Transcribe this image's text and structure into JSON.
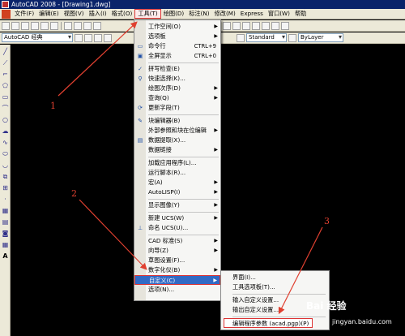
{
  "window": {
    "title": "AutoCAD 2008 - [Drawing1.dwg]"
  },
  "menubar": {
    "items": [
      "文件(F)",
      "编辑(E)",
      "视图(V)",
      "插入(I)",
      "格式(O)",
      "工具(T)",
      "绘图(D)",
      "标注(N)",
      "修改(M)",
      "Express",
      "窗口(W)",
      "帮助"
    ],
    "active": "工具(T)"
  },
  "toolbar2": {
    "workspace": "AutoCAD 经典",
    "textstyle": "Standard",
    "layer": "ByLayer"
  },
  "tools_menu": {
    "items": [
      {
        "label": "工作空间(O)",
        "arrow": true
      },
      {
        "label": "选项板",
        "arrow": true
      },
      {
        "label": "命令行",
        "shortcut": "CTRL+9",
        "icon": "command-line-icon"
      },
      {
        "label": "全屏显示",
        "shortcut": "CTRL+0",
        "icon": "clean-screen-icon"
      },
      {
        "label": "拼写检查(E)",
        "icon": "spell-check-icon"
      },
      {
        "label": "快速选择(K)...",
        "icon": "quick-select-icon"
      },
      {
        "label": "绘图次序(D)",
        "arrow": true
      },
      {
        "label": "查询(Q)",
        "arrow": true
      },
      {
        "label": "更新字段(T)",
        "icon": "update-field-icon"
      },
      {
        "label": "块编辑器(B)",
        "icon": "block-editor-icon"
      },
      {
        "label": "外部参照和块在位编辑",
        "arrow": true
      },
      {
        "label": "数据提取(X)...",
        "icon": "data-extraction-icon"
      },
      {
        "label": "数据链接",
        "arrow": true
      },
      {
        "label": "加载应用程序(L)..."
      },
      {
        "label": "运行脚本(R)..."
      },
      {
        "label": "宏(A)",
        "arrow": true
      },
      {
        "label": "AutoLISP(I)",
        "arrow": true
      },
      {
        "label": "显示图像(Y)",
        "arrow": true
      },
      {
        "label": "新建 UCS(W)",
        "arrow": true
      },
      {
        "label": "命名 UCS(U)...",
        "icon": "named-ucs-icon"
      },
      {
        "label": "CAD 标准(S)",
        "arrow": true
      },
      {
        "label": "向导(Z)",
        "arrow": true
      },
      {
        "label": "草图设置(F)..."
      },
      {
        "label": "数字化仪(B)",
        "arrow": true
      },
      {
        "label": "自定义(C)",
        "arrow": true
      },
      {
        "label": "选项(N)..."
      }
    ]
  },
  "customize_submenu": {
    "items": [
      "界面(I)...",
      "工具选项板(T)...",
      "输入自定义设置...",
      "输出自定义设置...",
      "编辑程序参数 (acad.pgp)(P)"
    ]
  },
  "annotations": [
    "1",
    "2",
    "3"
  ],
  "watermark": {
    "brand": "Bai 经验",
    "url": "jingyan.baidu.com"
  }
}
